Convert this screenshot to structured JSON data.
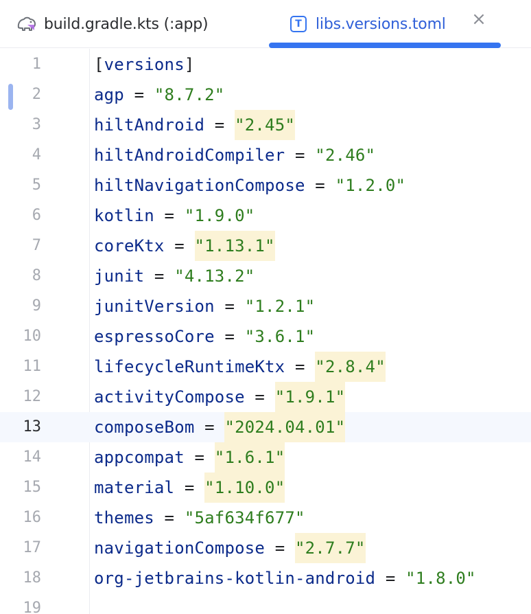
{
  "tabs": [
    {
      "label": "build.gradle.kts (:app)",
      "icon": "gradle-elephant-icon",
      "active": false
    },
    {
      "label": "libs.versions.toml",
      "icon": "toml-file-icon",
      "icon_glyph": "T",
      "active": true
    }
  ],
  "close_glyph": "×",
  "current_line": 13,
  "accent_color": "#3574f0",
  "section": {
    "open": "[",
    "name": "versions",
    "close": "]"
  },
  "equals": " = ",
  "line_numbers": [
    "1",
    "2",
    "3",
    "4",
    "5",
    "6",
    "7",
    "8",
    "9",
    "10",
    "11",
    "12",
    "13",
    "14",
    "15",
    "16",
    "17",
    "18",
    "19"
  ],
  "entries": [
    {
      "key": "agp",
      "value": "\"8.7.2\"",
      "highlighted": false
    },
    {
      "key": "hiltAndroid",
      "value": "\"2.45\"",
      "highlighted": true
    },
    {
      "key": "hiltAndroidCompiler",
      "value": "\"2.46\"",
      "highlighted": false
    },
    {
      "key": "hiltNavigationCompose",
      "value": "\"1.2.0\"",
      "highlighted": false
    },
    {
      "key": "kotlin",
      "value": "\"1.9.0\"",
      "highlighted": false
    },
    {
      "key": "coreKtx",
      "value": "\"1.13.1\"",
      "highlighted": true
    },
    {
      "key": "junit",
      "value": "\"4.13.2\"",
      "highlighted": false
    },
    {
      "key": "junitVersion",
      "value": "\"1.2.1\"",
      "highlighted": false
    },
    {
      "key": "espressoCore",
      "value": "\"3.6.1\"",
      "highlighted": false
    },
    {
      "key": "lifecycleRuntimeKtx",
      "value": "\"2.8.4\"",
      "highlighted": true
    },
    {
      "key": "activityCompose",
      "value": "\"1.9.1\"",
      "highlighted": true
    },
    {
      "key": "composeBom",
      "value": "\"2024.04.01\"",
      "highlighted": true
    },
    {
      "key": "appcompat",
      "value": "\"1.6.1\"",
      "highlighted": true
    },
    {
      "key": "material",
      "value": "\"1.10.0\"",
      "highlighted": true
    },
    {
      "key": "themes",
      "value": "\"5af634f677\"",
      "highlighted": false
    },
    {
      "key": "navigationCompose",
      "value": "\"2.7.7\"",
      "highlighted": true
    },
    {
      "key": "org-jetbrains-kotlin-android",
      "value": "\"1.8.0\"",
      "highlighted": false
    }
  ]
}
